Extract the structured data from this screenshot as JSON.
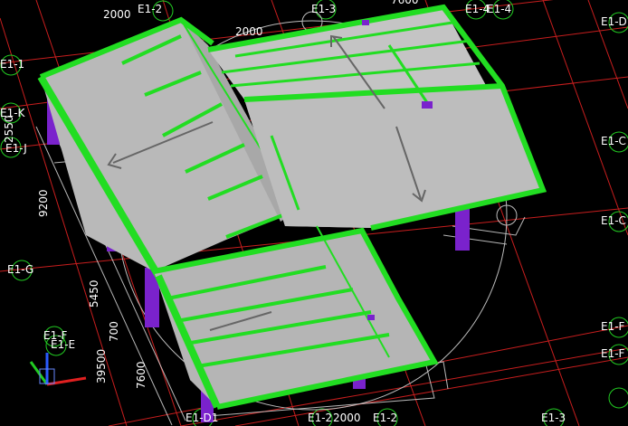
{
  "colors": {
    "background": "#000000",
    "grid_red": "#c81e1e",
    "grid_dark_red": "#5a0a0a",
    "foundation_white": "#d8d8d8",
    "roof_surface": "#b9b9b9",
    "beam_green": "#22dd22",
    "column_purple": "#7a22cc",
    "axis_x": "#e02020",
    "axis_y": "#22cc22",
    "axis_z": "#2a5bff"
  },
  "axis_labels": {
    "top_1": "2000",
    "top_2": "E1-2",
    "top_3": "2000",
    "top_4": "E1-3",
    "top_5": "7600",
    "top_6": "E1-4",
    "top_7": "E1-4",
    "left_1": "E1-1",
    "left_2": "E1-K",
    "left_3": "2550",
    "left_4": "E1-J",
    "left_5": "9200",
    "left_6": "E1-G",
    "left_7": "5450",
    "left_8": "700",
    "left_9": "E1-F",
    "left_10": "E1-E",
    "left_11": "39500",
    "left_12": "7600",
    "bottom_1": "E1-D1",
    "bottom_2": "E1-2",
    "bottom_3": "2000",
    "bottom_4": "E1-2",
    "bottom_5": "E1-3",
    "right_1": "E1-C",
    "right_2": "E1-C",
    "right_3": "E1-F",
    "right_4": "E1-F",
    "right_5": "E1-D"
  },
  "view_cube": {
    "name": "orbit-ring"
  }
}
